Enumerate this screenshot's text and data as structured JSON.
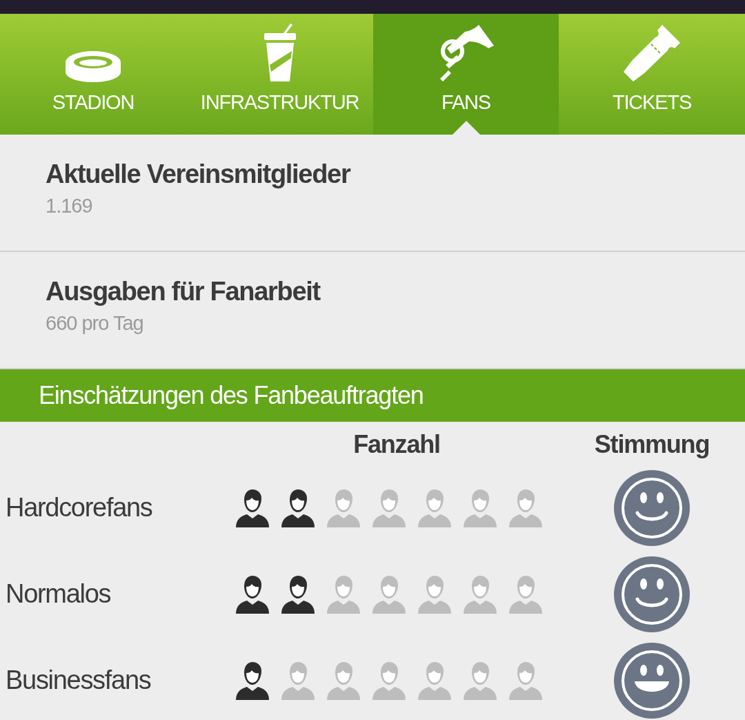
{
  "tabs": [
    {
      "label": "STADION",
      "kind": "stadium",
      "selected": false
    },
    {
      "label": "INFRASTRUKTUR",
      "kind": "cup",
      "selected": false
    },
    {
      "label": "FANS",
      "kind": "horn",
      "selected": true
    },
    {
      "label": "TICKETS",
      "kind": "ticket",
      "selected": false
    }
  ],
  "info": [
    {
      "title": "Aktuelle Vereinsmitglieder",
      "value": "1.169"
    },
    {
      "title": "Ausgaben für Fanarbeit",
      "value": "660 pro Tag"
    }
  ],
  "section": {
    "title": "Einschätzungen des Fanbeauftragten",
    "columns": [
      "Fanzahl",
      "Stimmung"
    ],
    "rows": [
      {
        "name": "Hardcorefans",
        "stars": 2,
        "kind": "smile"
      },
      {
        "name": "Normalos",
        "stars": 2,
        "kind": "smile"
      },
      {
        "name": "Businessfans",
        "stars": 1,
        "kind": "grin"
      }
    ]
  }
}
